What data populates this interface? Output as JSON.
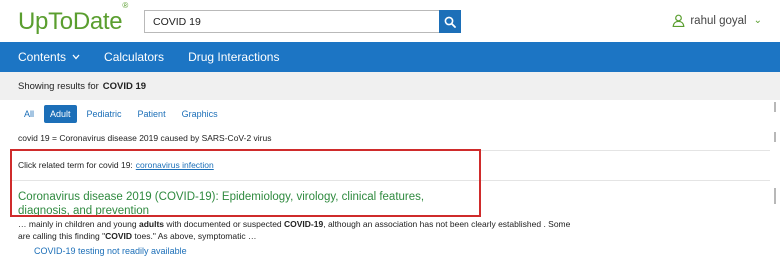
{
  "brand": {
    "name": "UpToDate",
    "mark": "®"
  },
  "search": {
    "value": "COVID 19"
  },
  "user": {
    "name": "rahul goyal"
  },
  "nav": [
    {
      "label": "Contents",
      "has_dropdown": true
    },
    {
      "label": "Calculators"
    },
    {
      "label": "Drug Interactions"
    }
  ],
  "results": {
    "prefix": "Showing results for",
    "query": "COVID 19"
  },
  "tabs": [
    {
      "label": "All"
    },
    {
      "label": "Adult",
      "active": true
    },
    {
      "label": "Pediatric"
    },
    {
      "label": "Patient"
    },
    {
      "label": "Graphics"
    }
  ],
  "definition": "covid 19 = Coronavirus disease 2019 caused by SARS-CoV-2 virus",
  "related": {
    "prefix": "Click related term for covid 19:",
    "link": "coronavirus infection"
  },
  "result": {
    "title": "Coronavirus disease 2019 (COVID-19): Epidemiology, virology, clinical features, diagnosis, and prevention",
    "snippet": {
      "part1": "… mainly in children and young ",
      "bold1": "adults",
      "part2": " with documented or suspected ",
      "bold2": "COVID-19",
      "part3": ", although an association has not been clearly established . Some are calling this finding \"",
      "bold3": "COVID",
      "part4": " toes.\" As above, symptomatic …"
    },
    "sublink": "COVID-19 testing not readily available"
  },
  "colors": {
    "brand_green": "#5a9e2f",
    "nav_blue": "#1c75c4",
    "link_blue": "#1c6fb8",
    "result_green": "#2f8a3f",
    "highlight_red": "#cf2b2b"
  }
}
